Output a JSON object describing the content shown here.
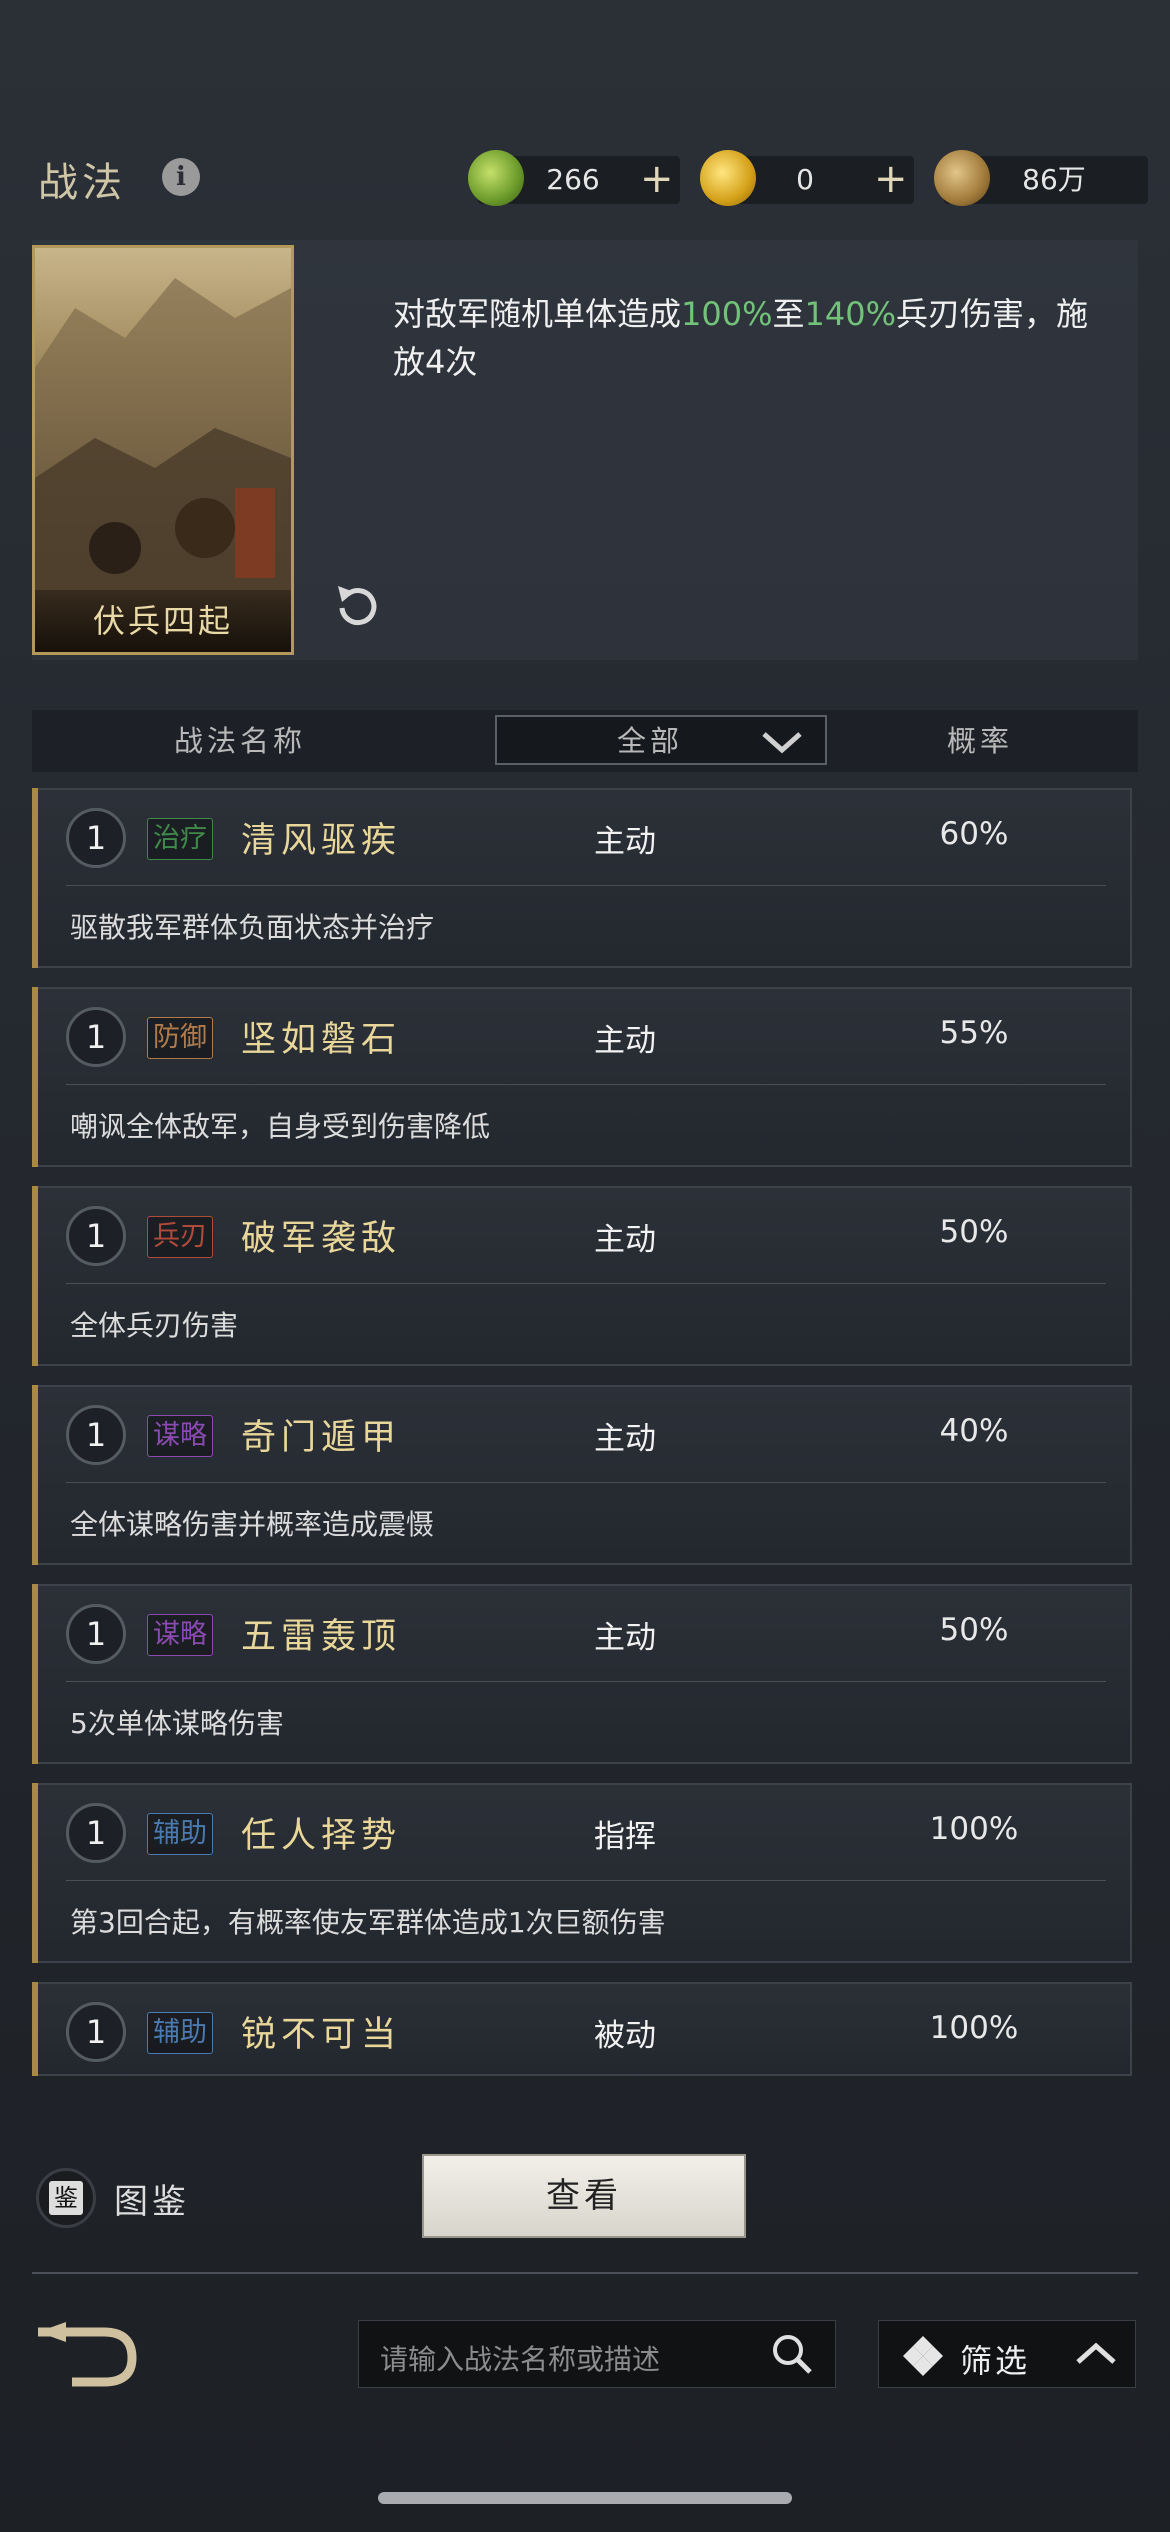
{
  "header": {
    "title": "战法",
    "currencies": [
      {
        "icon": "jade-icon",
        "value": "266",
        "has_plus": true
      },
      {
        "icon": "gold-coin-icon",
        "value": "0",
        "has_plus": true
      },
      {
        "icon": "copper-coin-icon",
        "value": "86万",
        "has_plus": false
      }
    ],
    "plus": "+"
  },
  "selected": {
    "card_name": "伏兵四起",
    "desc_parts": [
      "对敌军随机单体造成",
      "100%",
      "至",
      "140%",
      "兵刃伤害，施放4次"
    ]
  },
  "table": {
    "col_name": "战法名称",
    "col_filter": "全部",
    "col_rate": "概率"
  },
  "skills": [
    {
      "level": "1",
      "tag": "治疗",
      "tag_color": "#3f8a4a",
      "name": "清风驱疾",
      "type": "主动",
      "rate": "60%",
      "desc": "驱散我军群体负面状态并治疗"
    },
    {
      "level": "1",
      "tag": "防御",
      "tag_color": "#b07a4a",
      "name": "坚如磐石",
      "type": "主动",
      "rate": "55%",
      "desc": "嘲讽全体敌军，自身受到伤害降低"
    },
    {
      "level": "1",
      "tag": "兵刃",
      "tag_color": "#b04a3a",
      "name": "破军袭敌",
      "type": "主动",
      "rate": "50%",
      "desc": "全体兵刃伤害"
    },
    {
      "level": "1",
      "tag": "谋略",
      "tag_color": "#8a4ab0",
      "name": "奇门遁甲",
      "type": "主动",
      "rate": "40%",
      "desc": "全体谋略伤害并概率造成震慑"
    },
    {
      "level": "1",
      "tag": "谋略",
      "tag_color": "#8a4ab0",
      "name": "五雷轰顶",
      "type": "主动",
      "rate": "50%",
      "desc": "5次单体谋略伤害"
    },
    {
      "level": "1",
      "tag": "辅助",
      "tag_color": "#4a7ab0",
      "name": "任人择势",
      "type": "指挥",
      "rate": "100%",
      "desc": "第3回合起，有概率使友军群体造成1次巨额伤害"
    },
    {
      "level": "1",
      "tag": "辅助",
      "tag_color": "#4a7ab0",
      "name": "锐不可当",
      "type": "被动",
      "rate": "100%",
      "desc": ""
    }
  ],
  "bottom": {
    "tujian_icon_char": "鉴",
    "tujian_label": "图鉴",
    "view_button": "查看",
    "search_placeholder": "请输入战法名称或描述",
    "filter_label": "筛选"
  },
  "colors": {
    "green_value": "#72c27a",
    "gold_name": "#e9d79a"
  }
}
